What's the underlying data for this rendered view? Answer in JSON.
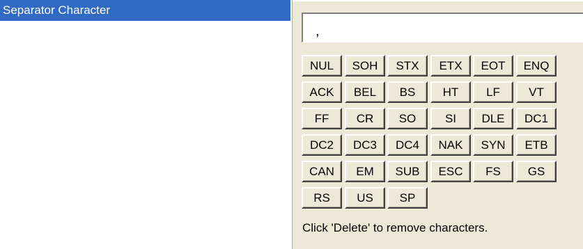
{
  "property_grid": {
    "selected_property": "Separator Character"
  },
  "editor": {
    "input_value": ",",
    "buttons": [
      [
        "NUL",
        "SOH",
        "STX",
        "ETX",
        "EOT",
        "ENQ"
      ],
      [
        "ACK",
        "BEL",
        "BS",
        "HT",
        "LF",
        "VT"
      ],
      [
        "FF",
        "CR",
        "SO",
        "SI",
        "DLE",
        "DC1"
      ],
      [
        "DC2",
        "DC3",
        "DC4",
        "NAK",
        "SYN",
        "ETB"
      ],
      [
        "CAN",
        "EM",
        "SUB",
        "ESC",
        "FS",
        "GS"
      ],
      [
        "RS",
        "US",
        "SP"
      ]
    ],
    "hint": "Click 'Delete' to remove characters."
  },
  "colors": {
    "selection": "#316ac5",
    "panel": "#ece9d8"
  }
}
